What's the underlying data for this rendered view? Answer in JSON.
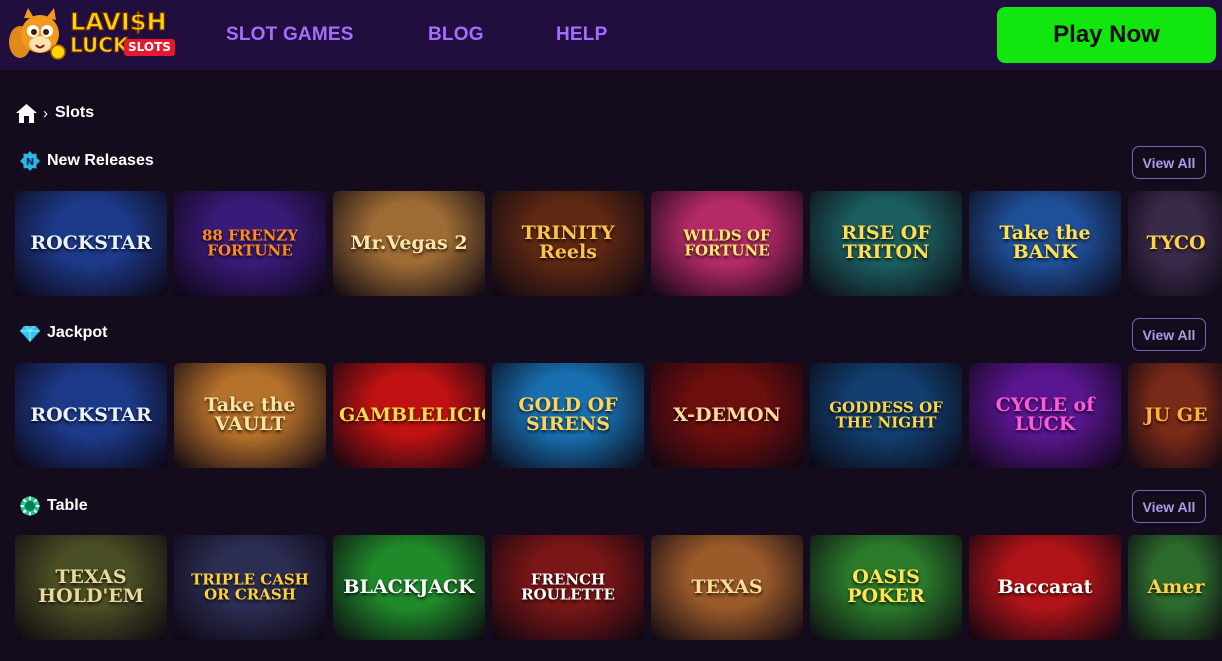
{
  "header": {
    "logo": {
      "line1": "LAVI$H",
      "line2": "LUCK",
      "badge": "SLOTS"
    },
    "nav": [
      "SLOT GAMES",
      "BLOG",
      "HELP"
    ],
    "cta_label": "Play Now"
  },
  "breadcrumb": {
    "current": "Slots"
  },
  "sections": [
    {
      "title": "New Releases",
      "icon": "new-badge-icon",
      "view_all": "View All",
      "games": [
        {
          "label": "ROCKSTAR",
          "bg": "#1d3a8a",
          "fg": "#e9f1ff"
        },
        {
          "label": "88 FRENZY FORTUNE",
          "bg": "#3a1a78",
          "fg": "#ff8c1a"
        },
        {
          "label": "Mr.Vegas 2",
          "bg": "#9d6b34",
          "fg": "#ffe6a8"
        },
        {
          "label": "TRINITY Reels",
          "bg": "#5e2913",
          "fg": "#ffc24d"
        },
        {
          "label": "WILDS OF FORTUNE",
          "bg": "#b42a66",
          "fg": "#ffe96a"
        },
        {
          "label": "RISE OF TRITON",
          "bg": "#1b5e5e",
          "fg": "#ffdd55"
        },
        {
          "label": "Take the BANK",
          "bg": "#1f4f97",
          "fg": "#ffe252"
        },
        {
          "label": "TYCO",
          "bg": "#3a2a4a",
          "fg": "#ffd24a"
        }
      ]
    },
    {
      "title": "Jackpot",
      "icon": "diamond-icon",
      "view_all": "View All",
      "games": [
        {
          "label": "ROCKSTAR",
          "bg": "#1d3a8a",
          "fg": "#e9f1ff"
        },
        {
          "label": "Take the VAULT",
          "bg": "#b5702a",
          "fg": "#ffe3a0"
        },
        {
          "label": "GAMBLELICIOUS",
          "bg": "#c01212",
          "fg": "#ffd94a"
        },
        {
          "label": "GOLD OF SIRENS",
          "bg": "#176fb0",
          "fg": "#ffd45a"
        },
        {
          "label": "X-DEMON",
          "bg": "#6d0e0e",
          "fg": "#ffd9a0"
        },
        {
          "label": "GODDESS OF THE NIGHT",
          "bg": "#123f6f",
          "fg": "#ffd64a"
        },
        {
          "label": "CYCLE of LUCK",
          "bg": "#5a1690",
          "fg": "#ff5ad9"
        },
        {
          "label": "JU GE",
          "bg": "#7a2a18",
          "fg": "#ffb23a"
        }
      ]
    },
    {
      "title": "Table",
      "icon": "poker-chip-icon",
      "view_all": "View All",
      "games": [
        {
          "label": "TEXAS HOLD'EM",
          "bg": "#4a4e24",
          "fg": "#e9d99a"
        },
        {
          "label": "TRIPLE CASH OR CRASH",
          "bg": "#2b2d52",
          "fg": "#ffd23a"
        },
        {
          "label": "BLACKJACK",
          "bg": "#1f8a2a",
          "fg": "#ffffff"
        },
        {
          "label": "FRENCH ROULETTE",
          "bg": "#7a1616",
          "fg": "#ffffff"
        },
        {
          "label": "TEXAS",
          "bg": "#9a5a2a",
          "fg": "#ffdf8f"
        },
        {
          "label": "OASIS POKER",
          "bg": "#2a7a2a",
          "fg": "#ffe45a"
        },
        {
          "label": "Baccarat",
          "bg": "#b01418",
          "fg": "#ffffff"
        },
        {
          "label": "Amer",
          "bg": "#2c6a2c",
          "fg": "#ffd24a"
        }
      ]
    }
  ]
}
